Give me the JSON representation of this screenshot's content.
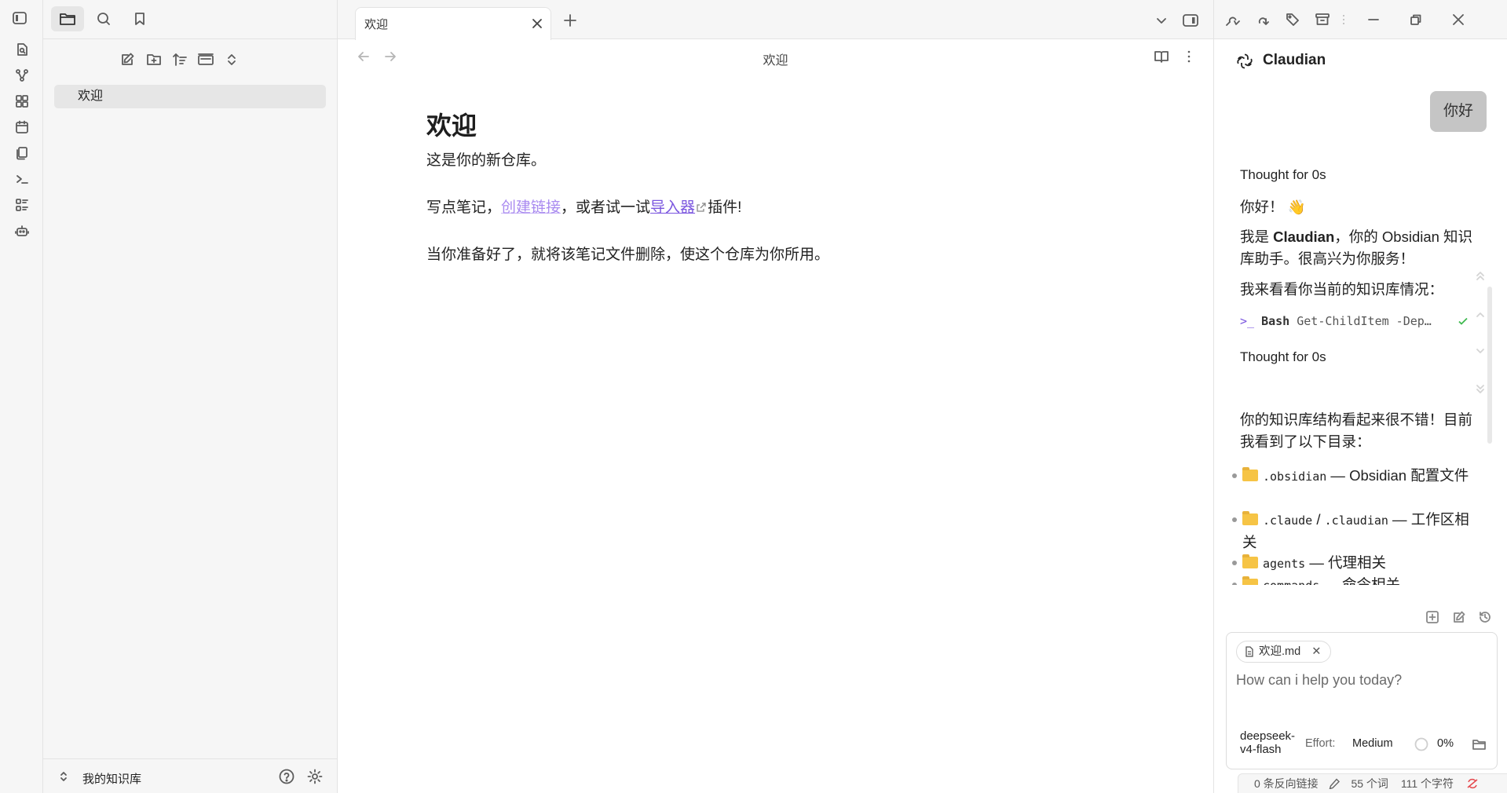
{
  "sidebar": {
    "tabs": [
      "files-icon",
      "search-icon",
      "bookmark-icon"
    ],
    "explorer_actions": [
      "new-note-icon",
      "new-folder-icon",
      "sort-icon",
      "collapse-icon",
      "expand-icon"
    ],
    "files": [
      {
        "name": "欢迎"
      }
    ],
    "vault_name": "我的知识库"
  },
  "ribbon": {
    "items": [
      "quick-switcher-icon",
      "graph-icon",
      "canvas-icon",
      "calendar-icon",
      "templates-icon",
      "terminal-icon",
      "command-palette-icon",
      "bot-icon"
    ]
  },
  "editor": {
    "tab_title": "欢迎",
    "view_title": "欢迎",
    "doc": {
      "heading": "欢迎",
      "p1": "这是你的新仓库。",
      "p2_pre": "写点笔记，",
      "p2_link1": "创建链接",
      "p2_mid": "，或者试一试",
      "p2_link2": "导入器",
      "p2_post": "插件!",
      "p3": "当你准备好了，就将该笔记文件删除，使这个仓库为你所用。"
    }
  },
  "claudian": {
    "title": "Claudian",
    "user_message": "你好",
    "thought1": "Thought for 0s",
    "greeting": "你好！",
    "greeting_emoji": "👋",
    "intro_pre": "我是 ",
    "intro_bold": "Claudian",
    "intro_post": "，你的 Obsidian 知识库助手。很高兴为你服务！",
    "check_text": "我来看看你当前的知识库情况：",
    "tool_name": "Bash",
    "tool_cmd": "Get-ChildItem -Dep…",
    "thought2": "Thought for 0s",
    "summary": "你的知识库结构看起来很不错！目前我看到了以下目录：",
    "dirs": [
      {
        "code": ".obsidian",
        "sep": " — ",
        "desc": "Obsidian 配置文件"
      },
      {
        "code": ".claude",
        "mid": " / ",
        "code2": ".claudian",
        "sep": " — ",
        "desc": "工作区相关"
      },
      {
        "code": "agents",
        "sep": " — ",
        "desc": "代理相关"
      },
      {
        "code": "commands",
        "sep": " — ",
        "desc": "命令相关"
      }
    ],
    "context_file": "欢迎.md",
    "input_placeholder": "How can i help you today?",
    "model": "deepseek-v4-flash",
    "effort_label": "Effort:",
    "effort_value": "Medium",
    "context_usage": "0%"
  },
  "status_bar": {
    "backlinks": "0 条反向链接",
    "words": "55 个词",
    "chars": "111 个字符"
  },
  "colors": {
    "accent": "#7a55df",
    "internal_link": "#a98af0",
    "bubble": "#c5c5c5",
    "check": "#3fb950"
  }
}
